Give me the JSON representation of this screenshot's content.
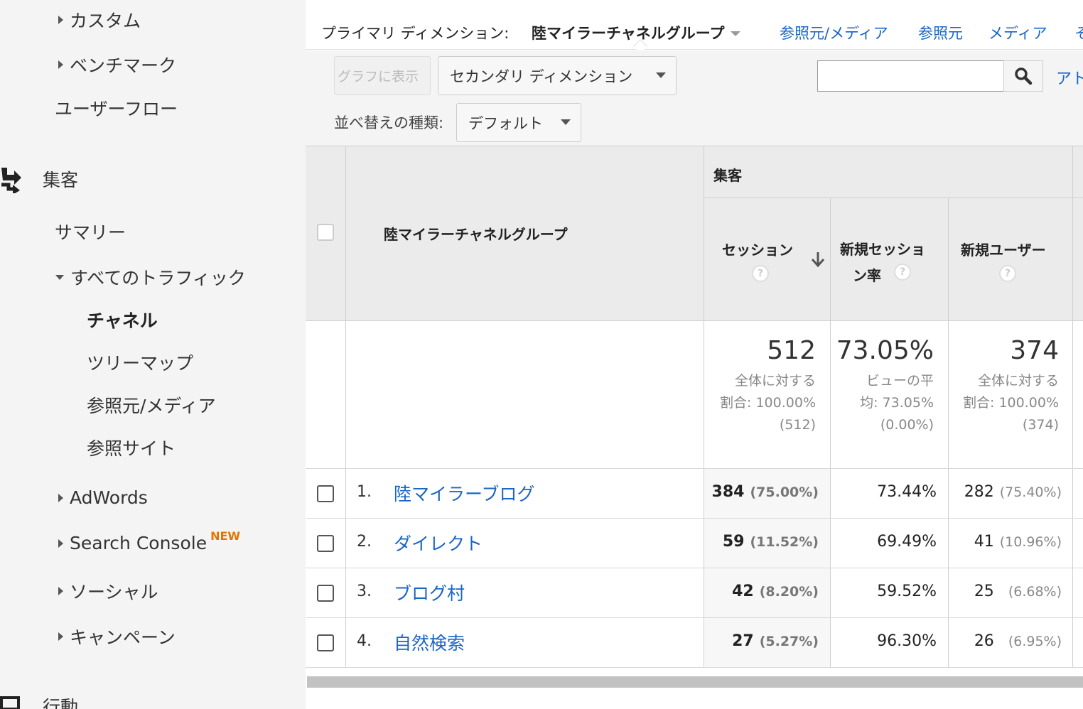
{
  "sidebar": {
    "items": [
      {
        "label": "カスタム",
        "caret": "right"
      },
      {
        "label": "ベンチマーク",
        "caret": "right"
      },
      {
        "label": "ユーザーフロー",
        "caret": "none"
      },
      {
        "label": "集客",
        "caret": "section"
      },
      {
        "label": "サマリー",
        "caret": "none"
      },
      {
        "label": "すべてのトラフィック",
        "caret": "down"
      },
      {
        "label": "チャネル",
        "caret": "none",
        "active": true
      },
      {
        "label": "ツリーマップ",
        "caret": "none"
      },
      {
        "label": "参照元/メディア",
        "caret": "none"
      },
      {
        "label": "参照サイト",
        "caret": "none"
      },
      {
        "label": "AdWords",
        "caret": "right"
      },
      {
        "label": "Search Console",
        "caret": "right",
        "badge": "NEW"
      },
      {
        "label": "ソーシャル",
        "caret": "right"
      },
      {
        "label": "キャンペーン",
        "caret": "right"
      },
      {
        "label": "行動",
        "caret": "section"
      }
    ]
  },
  "dimension_bar": {
    "label": "プライマリ ディメンション:",
    "current": "陸マイラーチャネルグループ",
    "links": [
      "参照元/メディア",
      "参照元",
      "メディア",
      "そ"
    ]
  },
  "toolbar": {
    "graph_button": "グラフに表示",
    "secondary_dimension": "セカンダリ ディメンション",
    "sort_label": "並べ替えの種類:",
    "sort_value": "デフォルト",
    "search_value": "",
    "advanced_link": "アト"
  },
  "table": {
    "group_header": "集客",
    "dimension_header": "陸マイラーチャネルグループ",
    "columns": [
      "セッション",
      "新規セッション率",
      "新規ユーザー"
    ],
    "column_lines": [
      [
        "セッション"
      ],
      [
        "新規セッショ",
        "ン率"
      ],
      [
        "新規ユーザー"
      ]
    ],
    "totals": [
      {
        "main": "512",
        "sub": [
          "全体に対する",
          "割合: 100.00%",
          "(512)"
        ]
      },
      {
        "main": "73.05%",
        "sub": [
          "ビューの平",
          "均: 73.05%",
          "(0.00%)"
        ]
      },
      {
        "main": "374",
        "sub": [
          "全体に対する",
          "割合: 100.00%",
          "(374)"
        ]
      }
    ],
    "rows": [
      {
        "num": "1.",
        "name": "陸マイラーブログ",
        "sessions": "384",
        "sessions_pct": "(75.00%)",
        "new_rate": "73.44%",
        "new_users": "282",
        "new_users_pct": "(75.40%)"
      },
      {
        "num": "2.",
        "name": "ダイレクト",
        "sessions": "59",
        "sessions_pct": "(11.52%)",
        "new_rate": "69.49%",
        "new_users": "41",
        "new_users_pct": "(10.96%)"
      },
      {
        "num": "3.",
        "name": "ブログ村",
        "sessions": "42",
        "sessions_pct": "(8.20%)",
        "new_rate": "59.52%",
        "new_users": "25",
        "new_users_pct": "(6.68%)"
      },
      {
        "num": "4.",
        "name": "自然検索",
        "sessions": "27",
        "sessions_pct": "(5.27%)",
        "new_rate": "96.30%",
        "new_users": "26",
        "new_users_pct": "(6.95%)"
      }
    ]
  },
  "colors": {
    "link": "#1a66c4",
    "badge": "#e37400",
    "sidebar_bg": "#f4f4f4",
    "header_bg": "#ebebeb"
  }
}
